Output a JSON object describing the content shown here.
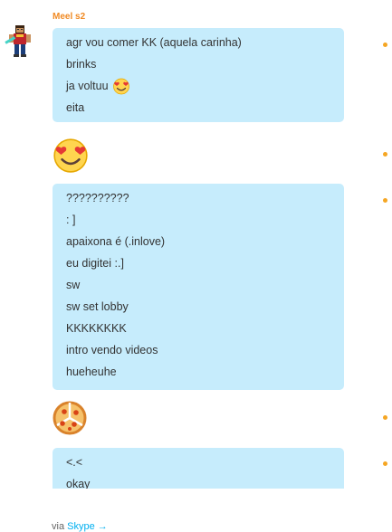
{
  "conversation": {
    "sender_name": "Meel s2",
    "message_groups": [
      {
        "lines": [
          "agr vou comer KK (aquela carinha)",
          "brinks",
          "ja voltuu",
          "eita"
        ],
        "emoji_after_line_index": 2,
        "emoji": "inlove-emoticon"
      },
      {
        "type": "emoticon",
        "emoji": "inlove-emoticon"
      },
      {
        "lines": [
          "??????????",
          ":  ]",
          "apaixona é (.inlove)",
          "eu digitei :.]",
          "sw",
          "sw set lobby",
          "KKKKKKKK",
          "intro vendo videos",
          "hueheuhe"
        ]
      },
      {
        "type": "emoticon",
        "emoji": "pizza-emoticon"
      },
      {
        "lines": [
          "<.<",
          "okay"
        ]
      }
    ]
  },
  "footer": {
    "via_text": "via",
    "link_text": "Skype",
    "arrow": "→"
  },
  "colors": {
    "bubble": "#c6ecfc",
    "sender": "#f08a24",
    "status_dot": "#f5a623",
    "link": "#00aff0"
  }
}
